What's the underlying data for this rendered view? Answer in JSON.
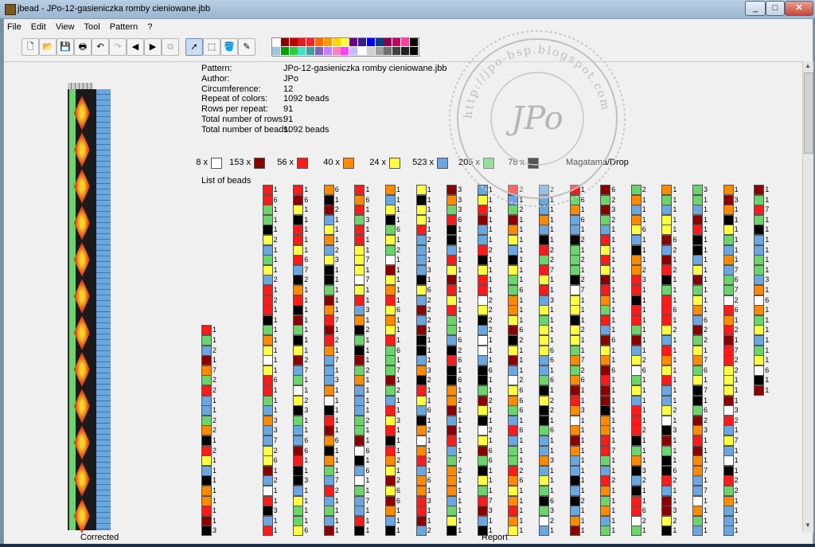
{
  "window": {
    "title": "jbead - JPo-12-gasieniczka romby cieniowane.jbb"
  },
  "menu": [
    "File",
    "Edit",
    "View",
    "Tool",
    "Pattern",
    "?"
  ],
  "toolbar": {
    "icons": [
      "new-icon",
      "open-icon",
      "save-icon",
      "print-icon",
      "undo-icon",
      "redo-icon",
      "arrow-left-icon",
      "arrow-right-icon",
      "copy-icon",
      "select-icon",
      "rect-select-icon",
      "fill-icon",
      "pipette-icon"
    ]
  },
  "palette": {
    "row1": [
      "#ffffff",
      "#8b0000",
      "#c00000",
      "#e31b1b",
      "#ff2020",
      "#ff6a00",
      "#ff9a00",
      "#ffd700",
      "#ffff40",
      "#6a0080",
      "#3a1c8c",
      "#0000ff",
      "#004080",
      "#8a0050",
      "#c00060",
      "#ff40a0",
      "#000000"
    ],
    "row2": [
      "#a0c4e4",
      "#00a000",
      "#2ecc40",
      "#40e0c0",
      "#40a0a0",
      "#8060c0",
      "#c080ff",
      "#ff80c0",
      "#ff40ff",
      "#c0c0ff",
      "#ffffff",
      "#d0d0d0",
      "#a0a0a0",
      "#707070",
      "#404040",
      "#202020",
      "#000000"
    ]
  },
  "info": {
    "labels": [
      "Pattern:",
      "Author:",
      "Circumference:",
      "Repeat of colors:",
      "Rows per repeat:",
      "Total number of rows:",
      "Total number of beads:"
    ],
    "values": [
      "JPo-12-gasieniczka romby cieniowane.jbb",
      "JPo",
      "12",
      "1092 beads",
      "91",
      "91",
      "1092 beads"
    ]
  },
  "legend": [
    {
      "count": "8 x",
      "color": "#ffffff"
    },
    {
      "count": "153 x",
      "color": "#8b0000"
    },
    {
      "count": "56 x",
      "color": "#ff1a1a"
    },
    {
      "count": "40 x",
      "color": "#ff8a00"
    },
    {
      "count": "24 x",
      "color": "#ffff40"
    },
    {
      "count": "523 x",
      "color": "#6aa6e0"
    },
    {
      "count": "205 x",
      "color": "#6bd46b"
    },
    {
      "count": "78 x",
      "color": "#000000"
    }
  ],
  "legend_note": "Magatama/Drop",
  "list_title": "List of beads",
  "captions": {
    "corrected": "Corrected",
    "report": "Report"
  },
  "watermark": {
    "text": "http://jpo-bsp.blogspot.com",
    "monogram": "JPo"
  },
  "colors": {
    "titlebar": "#aec6df",
    "window": "#f0f0f0",
    "draft_blue": "#6aa6e0",
    "draft_green": "#6bd46b",
    "draft_black": "#111111"
  }
}
